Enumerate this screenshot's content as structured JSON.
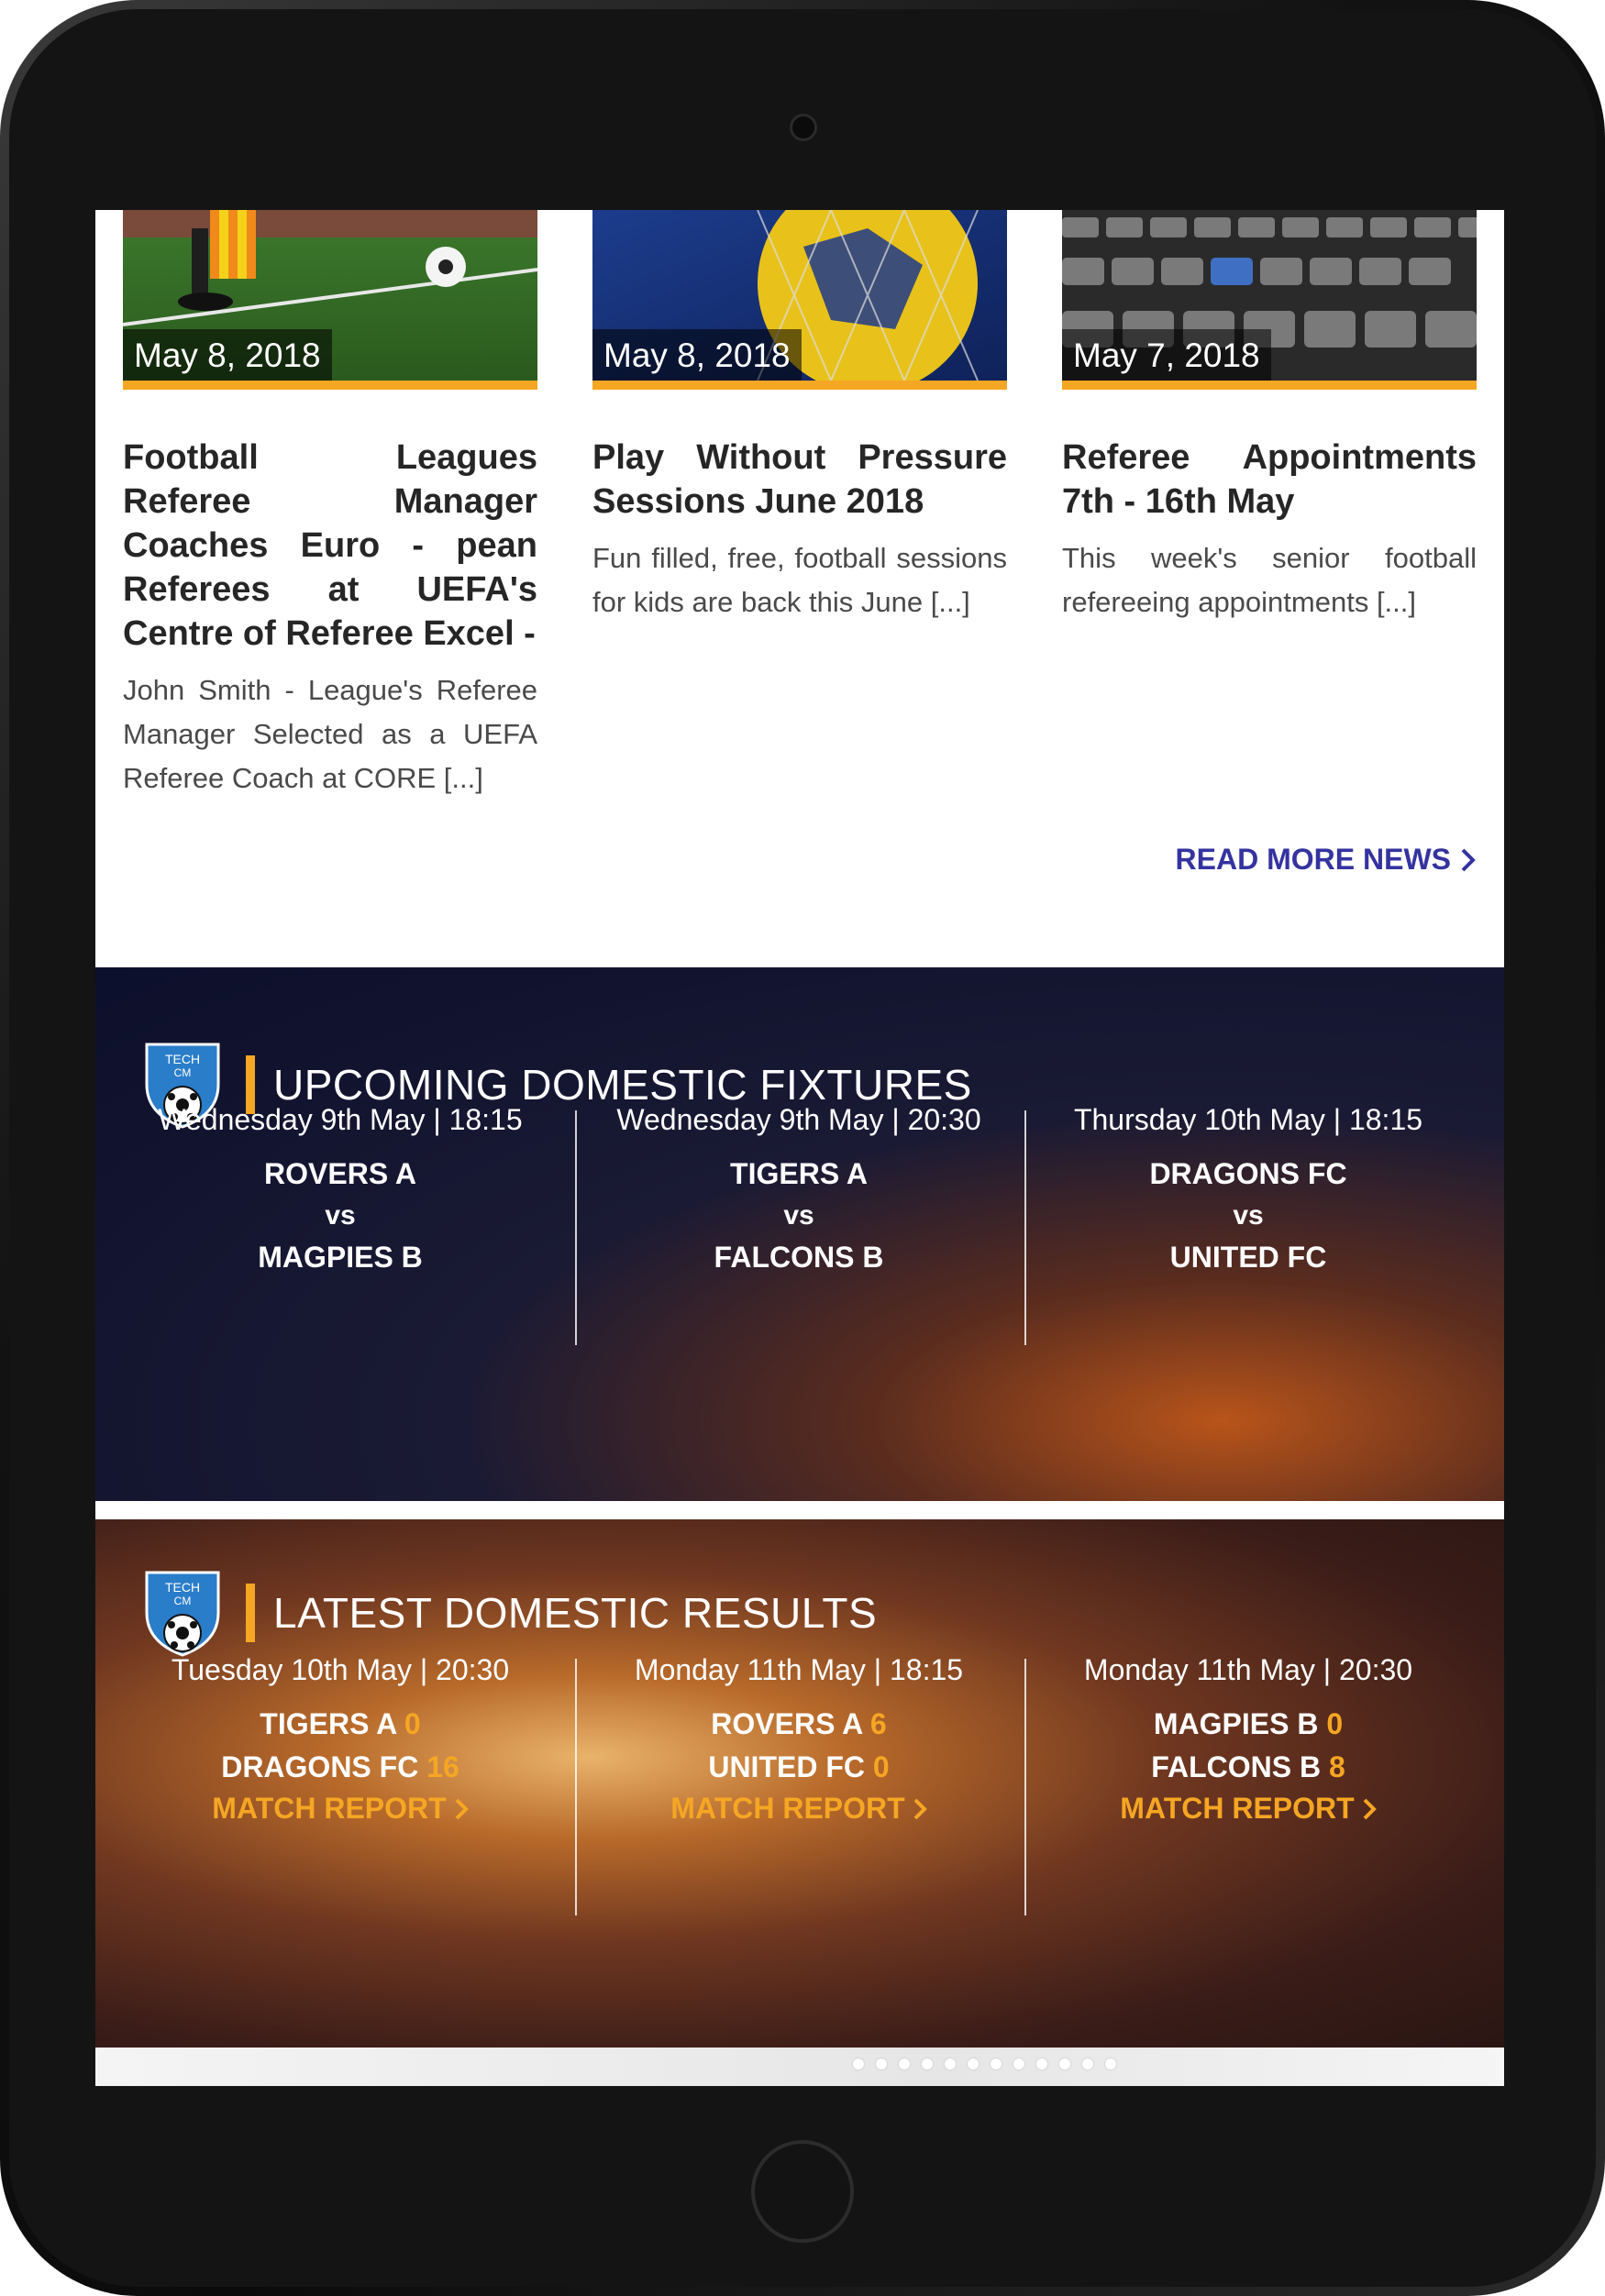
{
  "news": [
    {
      "date": "May 8, 2018",
      "title": "Football Leagues Referee Manager Coaches Euro - pean Referees at UEFA's Centre of Referee Excel -",
      "excerpt": "John Smith - League's Referee Manager Selected as a UEFA Referee Coach at CORE [...]"
    },
    {
      "date": "May 8, 2018",
      "title": "Play Without Pressure Sessions June 2018",
      "excerpt": "Fun filled, free, football sessions for kids are back this June [...]"
    },
    {
      "date": "May 7, 2018",
      "title": "Referee Appointments 7th - 16th May",
      "excerpt": "This week's senior football refereeing appointments [...]"
    }
  ],
  "read_more": "READ MORE NEWS",
  "logo_text": {
    "line1": "TECH",
    "line2": "CM"
  },
  "fixtures": {
    "title": "UPCOMING DOMESTIC FIXTURES",
    "items": [
      {
        "when": "Wednesday 9th May | 18:15",
        "home": "ROVERS A",
        "vs": "vs",
        "away": "MAGPIES B"
      },
      {
        "when": "Wednesday 9th May | 20:30",
        "home": "TIGERS A",
        "vs": "vs",
        "away": "FALCONS B"
      },
      {
        "when": "Thursday 10th May | 18:15",
        "home": "DRAGONS FC",
        "vs": "vs",
        "away": "UNITED FC"
      }
    ]
  },
  "results": {
    "title": "LATEST DOMESTIC RESULTS",
    "report_label": "MATCH REPORT",
    "items": [
      {
        "when": "Tuesday 10th May | 20:30",
        "home": "TIGERS A",
        "home_score": "0",
        "away": "DRAGONS FC",
        "away_score": "16"
      },
      {
        "when": "Monday 11th May | 18:15",
        "home": "ROVERS A",
        "home_score": "6",
        "away": "UNITED FC",
        "away_score": "0"
      },
      {
        "when": "Monday 11th May | 20:30",
        "home": "MAGPIES B",
        "home_score": "0",
        "away": "FALCONS B",
        "away_score": "8"
      }
    ]
  },
  "colors": {
    "accent": "#f5a623",
    "link": "#3533a0",
    "fixtures_bg": "#0c0f2b",
    "results_bg": "#6f3720"
  },
  "icons": {
    "chevron": "chevron-right-icon",
    "logo": "shield-logo-icon",
    "camera": "camera-icon",
    "home": "home-button-icon"
  }
}
